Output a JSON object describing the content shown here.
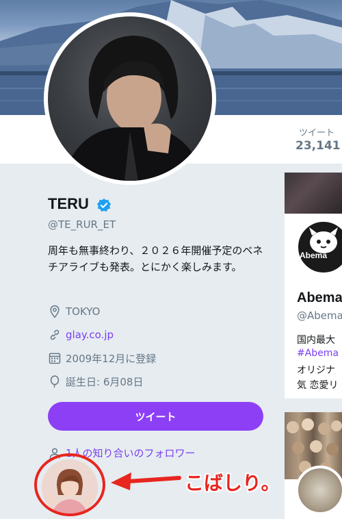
{
  "profile": {
    "name": "TERU",
    "handle": "@TE_RUR_ET",
    "bio": "周年も無事終わり、２０２６年開催予定のベネチアライブも発表。とにかく楽しみます。",
    "location": "TOKYO",
    "website": "glay.co.jp",
    "joined": "2009年12月に登録",
    "birthday": "誕生日: 6月08日"
  },
  "stats": {
    "tweets_label": "ツイート",
    "tweets_count": "23,141"
  },
  "actions": {
    "tweet_button": "ツイート",
    "followers_you_know": "1人の知り合いのフォロワー"
  },
  "annotation": {
    "text": "こばしり。",
    "color": "#e8251f"
  },
  "suggested": {
    "name": "Abema",
    "handle": "@Abema",
    "avatar_text": "Abema",
    "lines": [
      "国内最大",
      "#Abema",
      "オリジナ",
      "気 恋愛リ"
    ]
  },
  "colors": {
    "accent": "#8d3ff6",
    "link": "#7b3ff2",
    "verified": "#1da1f2"
  },
  "icons": [
    "location-icon",
    "link-icon",
    "calendar-icon",
    "balloon-icon",
    "followers-icon",
    "verified-icon"
  ]
}
